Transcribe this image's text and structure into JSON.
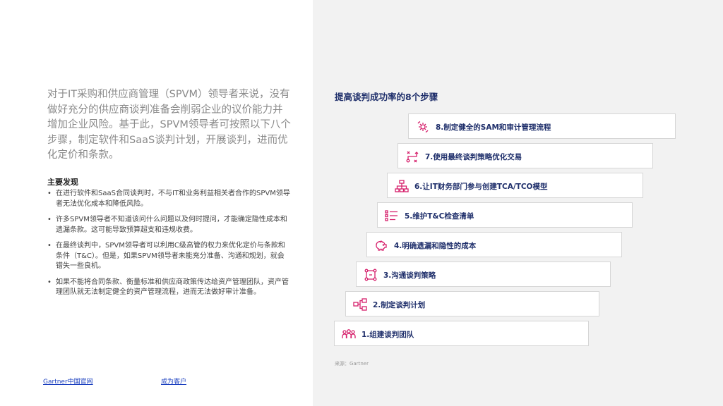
{
  "intro": "对于IT采购和供应商管理（SPVM）领导者来说，没有做好充分的供应商谈判准备会削弱企业的议价能力并增加企业风险。基于此，SPVM领导者可按照以下八个步骤，制定软件和SaaS谈判计划，开展谈判，进而优化定价和条款。",
  "findings": {
    "title": "主要发现",
    "bullet": "•",
    "items": [
      "在进行软件和SaaS合同谈判时，不与IT和业务利益相关者合作的SPVM领导者无法优化成本和降低风险。",
      "许多SPVM领导者不知道该问什么问题以及何时提问，才能确定隐性成本和遗漏条款。这可能导致预算超支和违规收费。",
      "在最终谈判中，SPVM领导者可以利用C级高管的权力来优化定价与条款和条件（T&C）。但是，如果SPVM领导者未能充分准备、沟通和规划，就会错失一些良机。",
      "如果不能将合同条款、衡量标准和供应商政策传达给资产管理团队，资产管理团队就无法制定健全的资产管理流程，进而无法做好审计准备。"
    ]
  },
  "links": {
    "gartner": "Gartner中国官网",
    "customer": "成为客户"
  },
  "steps": {
    "title": "提高谈判成功率的8个步骤",
    "accent_color": "#d61f6b",
    "items": [
      {
        "label": "8.制定健全的SAM和审计管理流程",
        "icon": "gear-cycle-icon"
      },
      {
        "label": "7.使用最终谈判策略优化交易",
        "icon": "strategy-flow-icon"
      },
      {
        "label": "6.让IT财务部门参与创建TCA/TCO模型",
        "icon": "org-chart-icon"
      },
      {
        "label": "5.维护T&C检查清单",
        "icon": "checklist-icon"
      },
      {
        "label": "4.明确遗漏和隐性的成本",
        "icon": "piggy-bank-icon"
      },
      {
        "label": "3.沟通谈判策略",
        "icon": "communication-flow-icon"
      },
      {
        "label": "2.制定谈判计划",
        "icon": "plan-flow-icon"
      },
      {
        "label": "1.组建谈判团队",
        "icon": "team-icon"
      }
    ]
  },
  "source": "来源：Gartner"
}
